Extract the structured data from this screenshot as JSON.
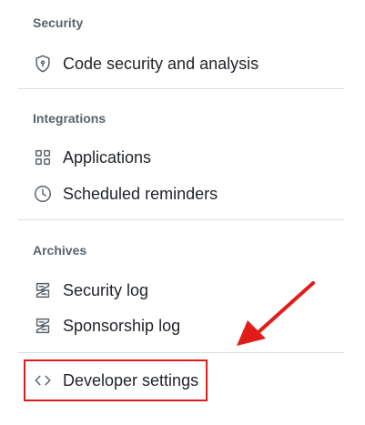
{
  "sections": {
    "security": {
      "heading": "Security",
      "items": [
        {
          "label": "Code security and analysis",
          "icon": "shield-lock-icon"
        }
      ]
    },
    "integrations": {
      "heading": "Integrations",
      "items": [
        {
          "label": "Applications",
          "icon": "apps-grid-icon"
        },
        {
          "label": "Scheduled reminders",
          "icon": "clock-icon"
        }
      ]
    },
    "archives": {
      "heading": "Archives",
      "items": [
        {
          "label": "Security log",
          "icon": "log-icon"
        },
        {
          "label": "Sponsorship log",
          "icon": "log-icon"
        }
      ]
    },
    "developer": {
      "items": [
        {
          "label": "Developer settings",
          "icon": "code-icon"
        }
      ]
    }
  },
  "annotation": {
    "highlight_color": "#e21b1b",
    "arrow_color": "#e21b1b"
  },
  "colors": {
    "heading": "#59636e",
    "text": "#1f2328",
    "icon": "#57606a",
    "divider": "#d8dee4"
  }
}
